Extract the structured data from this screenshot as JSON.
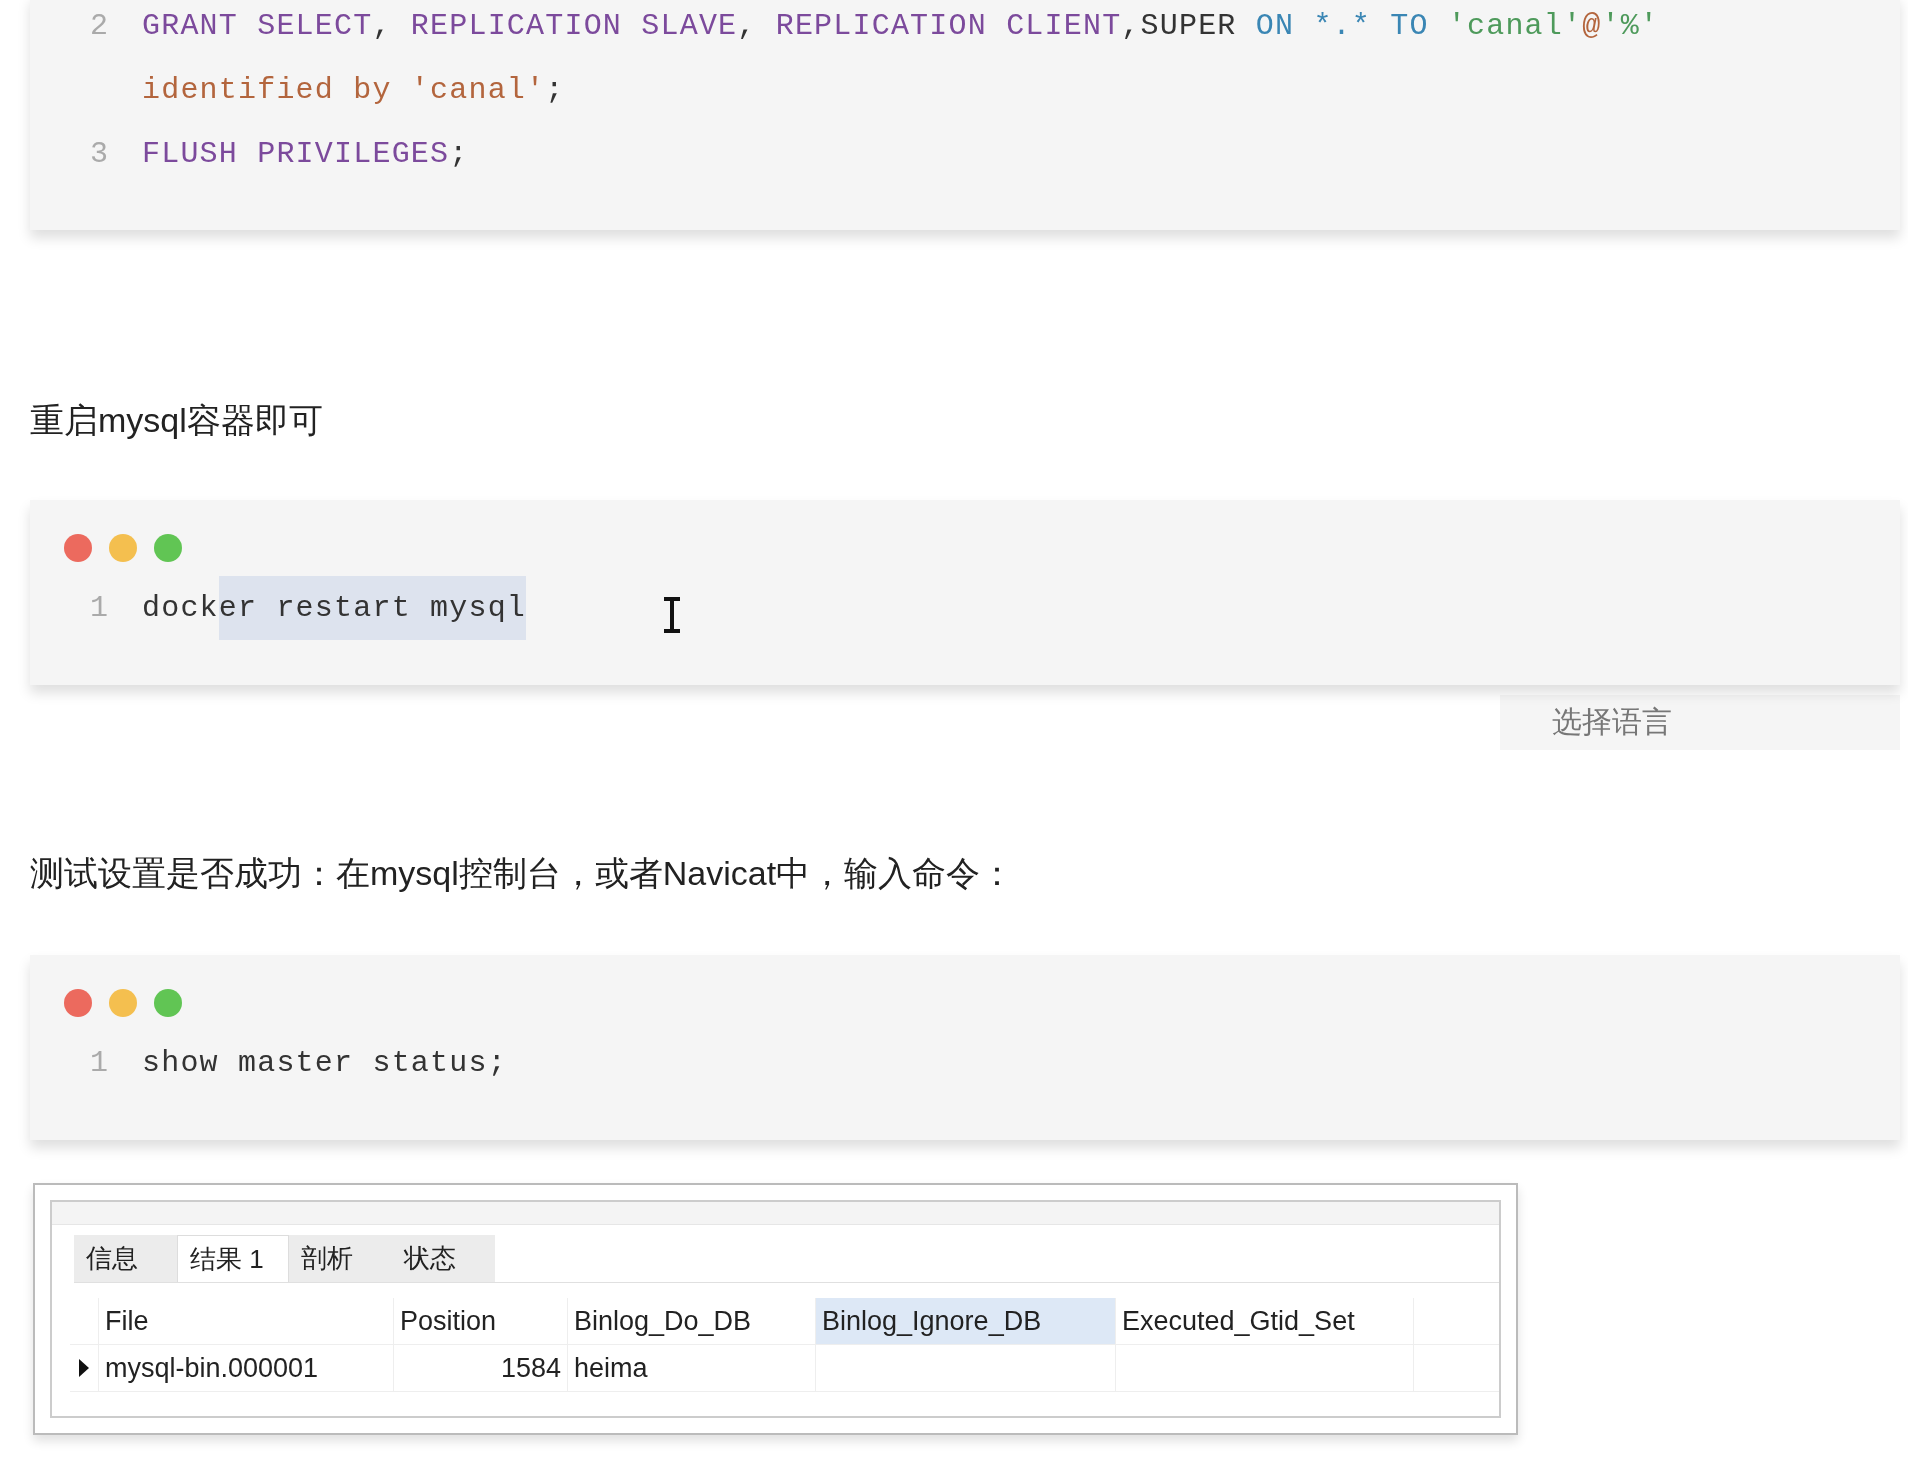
{
  "code_blocks": [
    {
      "window_controls": false,
      "cursor": false,
      "lines": [
        {
          "number": "2",
          "tokens": [
            {
              "text": "GRANT SELECT",
              "kind": "keyword"
            },
            {
              "text": ", ",
              "kind": "plain"
            },
            {
              "text": "REPLICATION SLAVE",
              "kind": "keyword"
            },
            {
              "text": ", ",
              "kind": "plain"
            },
            {
              "text": "REPLICATION CLIENT",
              "kind": "keyword"
            },
            {
              "text": ",SUPER ",
              "kind": "plain"
            },
            {
              "text": "ON ",
              "kind": "operator"
            },
            {
              "text": "*.* ",
              "kind": "operator"
            },
            {
              "text": "TO ",
              "kind": "operator"
            },
            {
              "text": "'canal'",
              "kind": "string"
            },
            {
              "text": "@",
              "kind": "attr"
            },
            {
              "text": "'%'",
              "kind": "string"
            },
            {
              "text": "identified by 'canal'",
              "kind": "attr",
              "wrap_before": true
            },
            {
              "text": ";",
              "kind": "plain"
            }
          ]
        },
        {
          "number": "3",
          "tokens": [
            {
              "text": "FLUSH PRIVILEGES",
              "kind": "keyword"
            },
            {
              "text": ";",
              "kind": "plain"
            }
          ]
        }
      ]
    },
    {
      "window_controls": true,
      "cursor": true,
      "lines": [
        {
          "number": "1",
          "tokens": [
            {
              "text": "dock",
              "kind": "plain",
              "selected": false
            },
            {
              "text": "er restart mysql",
              "kind": "plain",
              "selected": true
            }
          ]
        }
      ]
    },
    {
      "window_controls": true,
      "cursor": false,
      "lines": [
        {
          "number": "1",
          "tokens": [
            {
              "text": "show master status;",
              "kind": "plain"
            }
          ]
        }
      ]
    }
  ],
  "paragraphs": [
    "重启mysql容器即可",
    "测试设置是否成功：在mysql控制台，或者Navicat中，输入命令："
  ],
  "language_button": "选择语言",
  "result_panel": {
    "tabs": [
      {
        "label": "信息",
        "selected": false
      },
      {
        "label": "结果 1",
        "selected": true
      },
      {
        "label": "剖析",
        "selected": false
      },
      {
        "label": "状态",
        "selected": false
      }
    ],
    "columns": [
      {
        "label": "File",
        "selected": false
      },
      {
        "label": "Position",
        "selected": false
      },
      {
        "label": "Binlog_Do_DB",
        "selected": false
      },
      {
        "label": "Binlog_Ignore_DB",
        "selected": true
      },
      {
        "label": "Executed_Gtid_Set",
        "selected": false
      }
    ],
    "rows": [
      {
        "current": true,
        "cells": [
          "mysql-bin.000001",
          "1584",
          "heima",
          "",
          ""
        ]
      }
    ]
  }
}
